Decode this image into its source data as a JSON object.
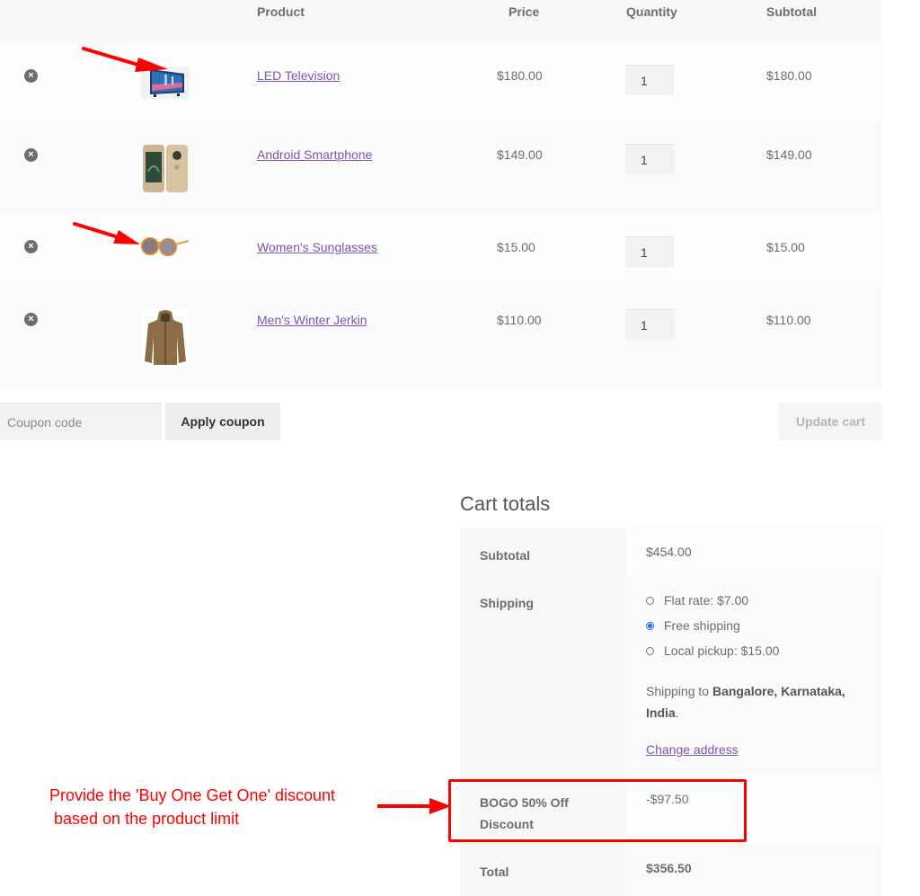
{
  "cart": {
    "columns": {
      "remove": "",
      "thumbnail": "",
      "product": "Product",
      "price": "Price",
      "quantity": "Quantity",
      "subtotal": "Subtotal"
    },
    "items": [
      {
        "name": "LED Television",
        "price": "$180.00",
        "quantity": "1",
        "subtotal": "$180.00",
        "image": "tv-image",
        "remove_icon": "remove-x-circle-icon"
      },
      {
        "name": "Android Smartphone",
        "price": "$149.00",
        "quantity": "1",
        "subtotal": "$149.00",
        "image": "smartphone-image",
        "remove_icon": "remove-x-circle-icon"
      },
      {
        "name": "Women's Sunglasses",
        "price": "$15.00",
        "quantity": "1",
        "subtotal": "$15.00",
        "image": "sunglasses-image",
        "remove_icon": "remove-x-circle-icon"
      },
      {
        "name": "Men's Winter Jerkin",
        "price": "$110.00",
        "quantity": "1",
        "subtotal": "$110.00",
        "image": "jacket-image",
        "remove_icon": "remove-x-circle-icon"
      }
    ],
    "remove_glyph": "×",
    "actions": {
      "coupon_placeholder": "Coupon code",
      "apply_coupon": "Apply coupon",
      "update_cart": "Update cart"
    }
  },
  "totals": {
    "title": "Cart totals",
    "subtotal_label": "Subtotal",
    "subtotal_value": "$454.00",
    "shipping_label": "Shipping",
    "shipping_options": [
      {
        "label": "Flat rate: $7.00",
        "checked": false
      },
      {
        "label": "Free shipping",
        "checked": true
      },
      {
        "label": "Local pickup: $15.00",
        "checked": false
      }
    ],
    "shipping_to_prefix": "Shipping to ",
    "shipping_to_location": "Bangalore, Karnataka, India",
    "shipping_to_suffix": ".",
    "change_address": "Change address",
    "discount_label": "BOGO 50% Off Discount",
    "discount_value": "-$97.50",
    "total_label": "Total",
    "total_value": "$356.50"
  },
  "annotation": {
    "line1": "Provide the 'Buy One Get One' discount",
    "line2": " based on the product limit",
    "color": "#ff0000"
  },
  "colors": {
    "link": "#7f54b3",
    "text": "#6d6d6d",
    "radio_checked": "#1a73e8"
  }
}
